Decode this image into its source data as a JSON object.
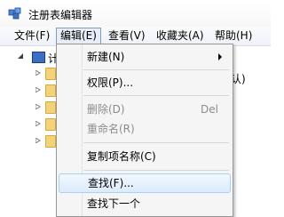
{
  "window": {
    "title": "注册表编辑器",
    "icon": "regedit-icon"
  },
  "menubar": {
    "items": [
      {
        "label": "文件(F)"
      },
      {
        "label": "编辑(E)"
      },
      {
        "label": "查看(V)"
      },
      {
        "label": "收藏夹(A)"
      },
      {
        "label": "帮助(H)"
      }
    ],
    "active": "编辑(E)"
  },
  "tree": {
    "root_label_partial": "计",
    "right_pane_partial": "认)"
  },
  "edit_menu": {
    "items": [
      {
        "label": "新建(N)",
        "shortcut": "",
        "has_submenu": true,
        "disabled": false
      },
      {
        "label": "权限(P)...",
        "shortcut": "",
        "has_submenu": false,
        "disabled": false
      },
      {
        "label": "删除(D)",
        "shortcut": "Del",
        "has_submenu": false,
        "disabled": true
      },
      {
        "label": "重命名(R)",
        "shortcut": "",
        "has_submenu": false,
        "disabled": true
      },
      {
        "label": "复制项名称(C)",
        "shortcut": "",
        "has_submenu": false,
        "disabled": false
      },
      {
        "label": "查找(F)...",
        "shortcut": "",
        "has_submenu": false,
        "disabled": false,
        "highlighted": true
      },
      {
        "label": "查找下一个",
        "shortcut": "",
        "has_submenu": false,
        "disabled": false
      }
    ]
  }
}
